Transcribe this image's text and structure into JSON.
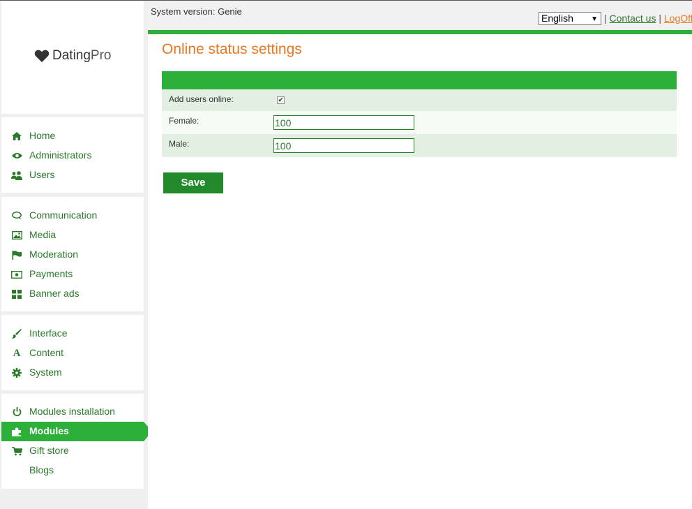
{
  "brand": {
    "name_main": "Dating",
    "name_accent": "Pro"
  },
  "header": {
    "system_version": "System version: Genie",
    "language": "English",
    "separator": "|",
    "contact_label": "Contact us",
    "logoff_label": "LogOff"
  },
  "page": {
    "title": "Online status settings"
  },
  "form": {
    "add_users_online_label": "Add users online:",
    "add_users_online_checked": true,
    "female_label": "Female:",
    "female_value": "100",
    "male_label": "Male:",
    "male_value": "100",
    "save_label": "Save"
  },
  "sidebar": {
    "items": [
      {
        "label": "Home",
        "icon": "home-icon"
      },
      {
        "label": "Administrators",
        "icon": "eye-icon"
      },
      {
        "label": "Users",
        "icon": "users-icon"
      },
      {
        "label": "Communication",
        "icon": "chat-icon"
      },
      {
        "label": "Media",
        "icon": "image-icon"
      },
      {
        "label": "Moderation",
        "icon": "flag-icon"
      },
      {
        "label": "Payments",
        "icon": "money-icon"
      },
      {
        "label": "Banner ads",
        "icon": "grid-icon"
      },
      {
        "label": "Interface",
        "icon": "brush-icon"
      },
      {
        "label": "Content",
        "icon": "font-icon"
      },
      {
        "label": "System",
        "icon": "gear-icon"
      },
      {
        "label": "Modules installation",
        "icon": "power-icon"
      },
      {
        "label": "Modules",
        "icon": "puzzle-icon",
        "active": true
      },
      {
        "label": "Gift store",
        "icon": "cart-icon"
      },
      {
        "label": "Blogs",
        "icon": ""
      }
    ]
  },
  "colors": {
    "accent_green": "#2db039",
    "link_green": "#2a7a2a",
    "title_orange": "#e87722"
  }
}
